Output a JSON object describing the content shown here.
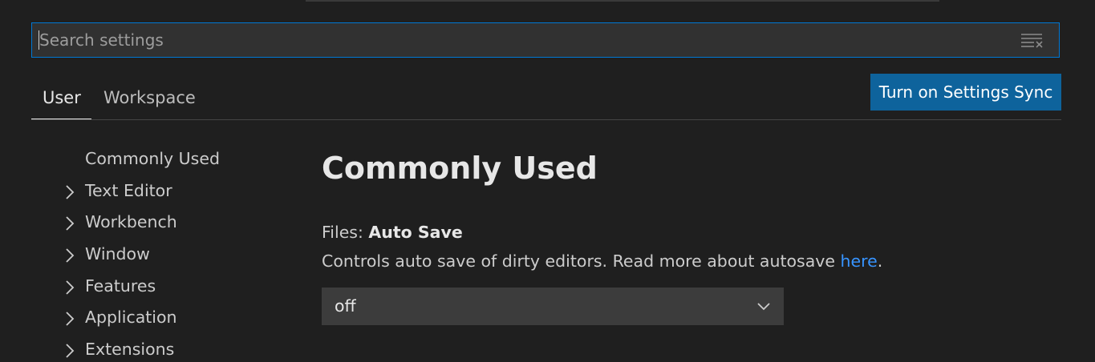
{
  "search": {
    "placeholder": "Search settings",
    "value": ""
  },
  "tabs": [
    {
      "label": "User",
      "active": true
    },
    {
      "label": "Workspace",
      "active": false
    }
  ],
  "sync_button": {
    "label": "Turn on Settings Sync"
  },
  "toc": {
    "items": [
      {
        "label": "Commonly Used",
        "has_chevron": false
      },
      {
        "label": "Text Editor",
        "has_chevron": true
      },
      {
        "label": "Workbench",
        "has_chevron": true
      },
      {
        "label": "Window",
        "has_chevron": true
      },
      {
        "label": "Features",
        "has_chevron": true
      },
      {
        "label": "Application",
        "has_chevron": true
      },
      {
        "label": "Extensions",
        "has_chevron": true
      }
    ]
  },
  "main": {
    "section_title": "Commonly Used",
    "setting": {
      "category": "Files: ",
      "name": "Auto Save",
      "description_prefix": "Controls auto save of dirty editors. Read more about autosave ",
      "link_text": "here",
      "description_suffix": ".",
      "value": "off"
    }
  },
  "icons": {
    "clear_filter": "clear-filter-icon",
    "chevron_right": "chevron-right-icon",
    "chevron_down": "chevron-down-icon"
  },
  "colors": {
    "background": "#1f1f1f",
    "accent": "#0078d4",
    "button": "#0e639c",
    "link": "#3794ff",
    "input_bg": "#313131",
    "select_bg": "#3c3c3c"
  }
}
